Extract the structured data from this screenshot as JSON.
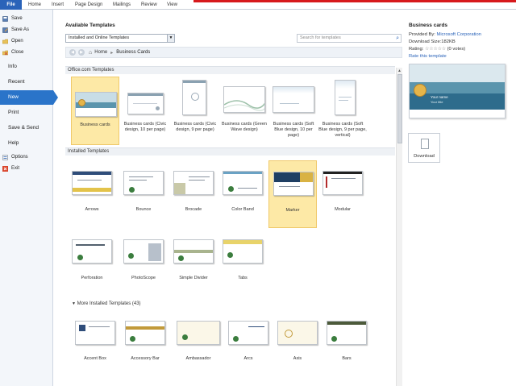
{
  "ribbon": {
    "file": "File",
    "tabs": [
      "Home",
      "Insert",
      "Page Design",
      "Mailings",
      "Review",
      "View"
    ]
  },
  "leftnav": {
    "save": "Save",
    "save_as": "Save As",
    "open": "Open",
    "close": "Close",
    "info": "Info",
    "recent": "Recent",
    "new": "New",
    "print": "Print",
    "save_send": "Save & Send",
    "help": "Help",
    "options": "Options",
    "exit": "Exit"
  },
  "main": {
    "title": "Available Templates",
    "source_dropdown": "Installed and Online Templates",
    "search_placeholder": "Search for templates",
    "breadcrumb_home": "Home",
    "breadcrumb_current": "Business Cards",
    "office_section": "Office.com Templates",
    "installed_section": "Installed Templates",
    "more_section": "More Installed Templates (43)",
    "office_templates": [
      "Business cards",
      "Business cards (Civic design, 10 per page)",
      "Business cards (Civic design, 9 per page)",
      "Business cards (Green Wave design)",
      "Business cards (Soft Blue design, 10 per page)",
      "Business cards (Soft Blue design, 9 per page, vertical)"
    ],
    "installed_templates": [
      "Arrows",
      "Bounce",
      "Brocade",
      "Color Band",
      "Marker",
      "Modular",
      "Perforation",
      "PhotoScope",
      "Simple Divider",
      "Tabs"
    ],
    "more_templates": [
      "Accent Box",
      "Accessory Bar",
      "Ambassador",
      "Arcs",
      "Axis",
      "Bars"
    ]
  },
  "right_pane": {
    "title": "Business cards",
    "provided_label": "Provided By:",
    "provider": "Microsoft Corporation",
    "download_size": "Download Size:182KB",
    "rating_label": "Rating:",
    "rating_stars": "☆☆☆☆☆",
    "votes": "(0 votes)",
    "rate_link": "Rate this template",
    "download_button": "Download",
    "preview_name": "Your name",
    "preview_title": "Your title"
  },
  "colors": {
    "file_tab": "#2a63b9",
    "selected_nav": "#2a74c9",
    "selected_card": "#fde9a6",
    "preview_band": "#5b95ad"
  }
}
